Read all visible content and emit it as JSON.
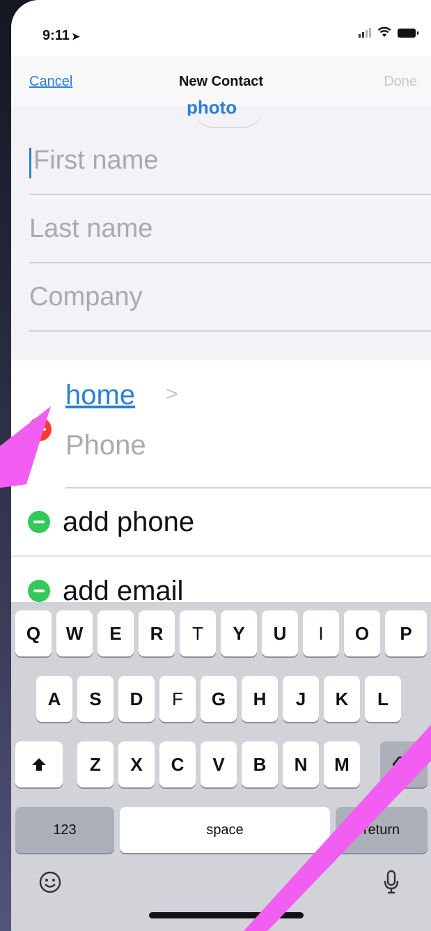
{
  "status_bar": {
    "time": "9:11",
    "location_arrow": "➤"
  },
  "nav": {
    "cancel_label": "Cancel",
    "title": "New Contact",
    "done_label": "Done"
  },
  "form": {
    "photo_link": "photo",
    "first_name_placeholder": "First name",
    "last_name_placeholder": "Last name",
    "company_placeholder": "Company",
    "phone_label": "home",
    "phone_chevron": ">",
    "phone_placeholder": "Phone",
    "add_phone_label": "add phone",
    "add_email_label": "add email"
  },
  "keyboard": {
    "row1": [
      "Q",
      "W",
      "E",
      "R",
      "T",
      "Y",
      "U",
      "I",
      "O",
      "P"
    ],
    "row2": [
      "A",
      "S",
      "D",
      "F",
      "G",
      "H",
      "J",
      "K",
      "L"
    ],
    "row3": [
      "Z",
      "X",
      "C",
      "V",
      "B",
      "N",
      "M"
    ],
    "numbers_label": "123",
    "space_label": "space",
    "return_label": "return"
  },
  "colors": {
    "accent": "#2a7fd4",
    "remove": "#ff3b30",
    "add": "#34c759",
    "annotation_arrow": "#f25ef2"
  },
  "icons": {
    "shift": "shift-icon",
    "backspace": "backspace-icon",
    "emoji": "emoji-icon",
    "mic": "microphone-icon"
  }
}
